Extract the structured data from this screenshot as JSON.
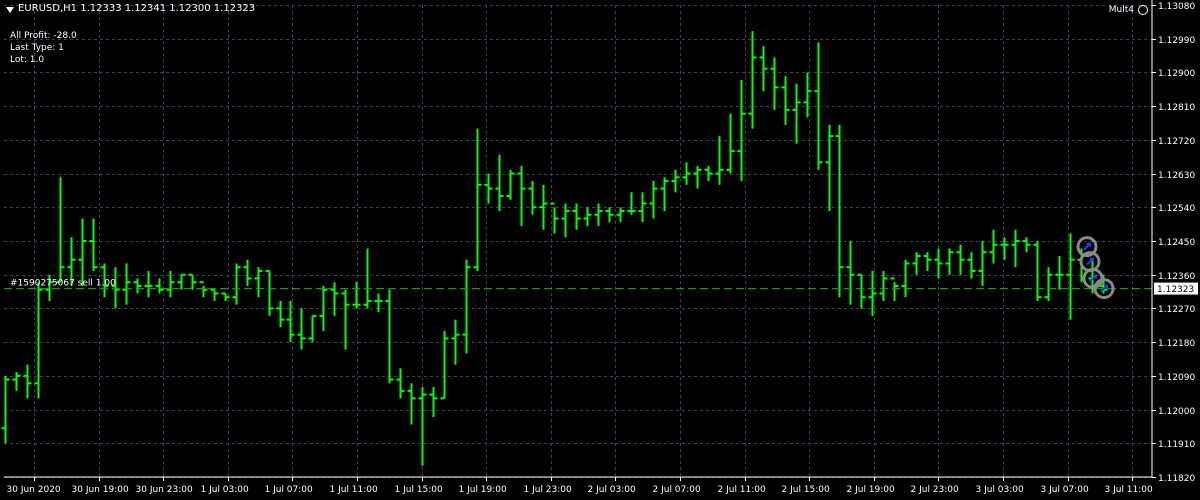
{
  "header": {
    "symbol": "EURUSD,H1",
    "ohlc": "1.12333 1.12341 1.12300 1.12323"
  },
  "info_panel": {
    "all_profit": "All Profit: -28.0",
    "last_type": "Last Type: 1",
    "lot": "Lot: 1.0"
  },
  "ea_label": "Mult4",
  "colors": {
    "background": "#000000",
    "bars": "#00FF00",
    "grid": "#394452",
    "order_line": "#00C000",
    "axis": "#FFFFFF",
    "price_label_bg": "#FFFFFF",
    "price_label_text": "#000000",
    "marker_ring": "#8A8A8A",
    "marker_arrow": "#1E3CFF"
  },
  "chart_data": {
    "type": "ohlc",
    "symbol": "EURUSD",
    "timeframe": "H1",
    "ylim": [
      1.1182,
      1.1308
    ],
    "y_ticks": [
      "1.13080",
      "1.12990",
      "1.12900",
      "1.12810",
      "1.12720",
      "1.12630",
      "1.12540",
      "1.12450",
      "1.12360",
      "1.12270",
      "1.12180",
      "1.12090",
      "1.12000",
      "1.11910",
      "1.11820"
    ],
    "x_ticks": [
      "30 Jun 2020",
      "30 Jun 19:00",
      "30 Jun 23:00",
      "1 Jul 03:00",
      "1 Jul 07:00",
      "1 Jul 11:00",
      "1 Jul 15:00",
      "1 Jul 19:00",
      "1 Jul 23:00",
      "2 Jul 03:00",
      "2 Jul 07:00",
      "2 Jul 11:00",
      "2 Jul 15:00",
      "2 Jul 19:00",
      "2 Jul 23:00",
      "3 Jul 03:00",
      "3 Jul 07:00",
      "3 Jul 11:00"
    ],
    "current_price": "1.12323",
    "order_line": {
      "label": "#1590275067 sell 1.00",
      "price": 1.12323
    },
    "bars": [
      [
        1.1195,
        1.1209,
        1.1191,
        1.1208
      ],
      [
        1.1208,
        1.121,
        1.1205,
        1.1209
      ],
      [
        1.1209,
        1.1212,
        1.1203,
        1.1207
      ],
      [
        1.1207,
        1.1234,
        1.1203,
        1.1232
      ],
      [
        1.1232,
        1.1236,
        1.1229,
        1.1234
      ],
      [
        1.1234,
        1.1262,
        1.1234,
        1.1238
      ],
      [
        1.1238,
        1.1246,
        1.1233,
        1.124
      ],
      [
        1.124,
        1.1251,
        1.1233,
        1.1245
      ],
      [
        1.1245,
        1.1251,
        1.1237,
        1.1238
      ],
      [
        1.1238,
        1.1239,
        1.123,
        1.1233
      ],
      [
        1.1233,
        1.1238,
        1.1227,
        1.1232
      ],
      [
        1.1232,
        1.1239,
        1.1228,
        1.1234
      ],
      [
        1.1234,
        1.1235,
        1.1231,
        1.1233
      ],
      [
        1.1233,
        1.1237,
        1.123,
        1.1233
      ],
      [
        1.1233,
        1.1235,
        1.1231,
        1.1232
      ],
      [
        1.1232,
        1.1237,
        1.123,
        1.1234
      ],
      [
        1.1234,
        1.1236,
        1.1232,
        1.1236
      ],
      [
        1.1236,
        1.1236,
        1.1232,
        1.1234
      ],
      [
        1.1234,
        1.1233,
        1.123,
        1.1232
      ],
      [
        1.1232,
        1.1232,
        1.1229,
        1.1231
      ],
      [
        1.1231,
        1.1231,
        1.1229,
        1.123
      ],
      [
        1.123,
        1.1239,
        1.1228,
        1.1238
      ],
      [
        1.1238,
        1.124,
        1.1233,
        1.1235
      ],
      [
        1.1235,
        1.1238,
        1.123,
        1.1237
      ],
      [
        1.1237,
        1.1237,
        1.1225,
        1.1227
      ],
      [
        1.1227,
        1.1229,
        1.1222,
        1.1224
      ],
      [
        1.1224,
        1.1229,
        1.1218,
        1.122
      ],
      [
        1.122,
        1.1227,
        1.1216,
        1.1219
      ],
      [
        1.1219,
        1.1225,
        1.1218,
        1.1225
      ],
      [
        1.1225,
        1.1233,
        1.1221,
        1.1232
      ],
      [
        1.1232,
        1.1234,
        1.1225,
        1.1231
      ],
      [
        1.1231,
        1.1232,
        1.1216,
        1.1228
      ],
      [
        1.1228,
        1.1234,
        1.1227,
        1.1228
      ],
      [
        1.1228,
        1.1243,
        1.1227,
        1.1229
      ],
      [
        1.1229,
        1.1231,
        1.1226,
        1.1229
      ],
      [
        1.1229,
        1.1232,
        1.1207,
        1.1208
      ],
      [
        1.1208,
        1.1211,
        1.1203,
        1.1205
      ],
      [
        1.1205,
        1.1207,
        1.1196,
        1.1203
      ],
      [
        1.1203,
        1.1206,
        1.1185,
        1.1204
      ],
      [
        1.1204,
        1.1206,
        1.1198,
        1.1203
      ],
      [
        1.1203,
        1.1221,
        1.1203,
        1.1219
      ],
      [
        1.1219,
        1.1224,
        1.1212,
        1.122
      ],
      [
        1.122,
        1.124,
        1.1215,
        1.1238
      ],
      [
        1.1238,
        1.1275,
        1.1237,
        1.126
      ],
      [
        1.126,
        1.1263,
        1.1255,
        1.1259
      ],
      [
        1.1259,
        1.1268,
        1.1253,
        1.1257
      ],
      [
        1.1257,
        1.1264,
        1.1256,
        1.1263
      ],
      [
        1.1263,
        1.1265,
        1.1249,
        1.1259
      ],
      [
        1.1259,
        1.1261,
        1.1252,
        1.1254
      ],
      [
        1.1254,
        1.126,
        1.1248,
        1.1255
      ],
      [
        1.1255,
        1.1254,
        1.1247,
        1.1251
      ],
      [
        1.1251,
        1.1255,
        1.1246,
        1.1253
      ],
      [
        1.1253,
        1.1255,
        1.1248,
        1.1251
      ],
      [
        1.1251,
        1.1254,
        1.1249,
        1.1252
      ],
      [
        1.1252,
        1.1255,
        1.1249,
        1.1253
      ],
      [
        1.1253,
        1.1254,
        1.125,
        1.1252
      ],
      [
        1.1252,
        1.1254,
        1.125,
        1.1253
      ],
      [
        1.1253,
        1.1258,
        1.1252,
        1.1253
      ],
      [
        1.1253,
        1.1258,
        1.125,
        1.1255
      ],
      [
        1.1255,
        1.1261,
        1.1251,
        1.1259
      ],
      [
        1.1259,
        1.1262,
        1.1253,
        1.1261
      ],
      [
        1.1261,
        1.1264,
        1.1258,
        1.1262
      ],
      [
        1.1262,
        1.1266,
        1.126,
        1.1263
      ],
      [
        1.1263,
        1.1265,
        1.1259,
        1.1264
      ],
      [
        1.1264,
        1.1265,
        1.1261,
        1.1263
      ],
      [
        1.1263,
        1.1273,
        1.126,
        1.1264
      ],
      [
        1.1264,
        1.1279,
        1.1263,
        1.1269
      ],
      [
        1.1269,
        1.1288,
        1.1261,
        1.1279
      ],
      [
        1.1279,
        1.1301,
        1.1275,
        1.1294
      ],
      [
        1.1294,
        1.1297,
        1.1285,
        1.1291
      ],
      [
        1.1291,
        1.1294,
        1.128,
        1.1286
      ],
      [
        1.1286,
        1.1289,
        1.1276,
        1.128
      ],
      [
        1.128,
        1.1287,
        1.1271,
        1.1282
      ],
      [
        1.1282,
        1.129,
        1.1278,
        1.1285
      ],
      [
        1.1285,
        1.1298,
        1.1264,
        1.1266
      ],
      [
        1.1266,
        1.1276,
        1.1253,
        1.1273
      ],
      [
        1.1273,
        1.1276,
        1.123,
        1.1238
      ],
      [
        1.1238,
        1.1245,
        1.1228,
        1.1236
      ],
      [
        1.1236,
        1.1236,
        1.1227,
        1.123
      ],
      [
        1.123,
        1.1237,
        1.1225,
        1.1231
      ],
      [
        1.1231,
        1.1237,
        1.1229,
        1.1235
      ],
      [
        1.1235,
        1.1234,
        1.1229,
        1.1233
      ],
      [
        1.1233,
        1.124,
        1.123,
        1.1239
      ],
      [
        1.1239,
        1.1242,
        1.1236,
        1.1241
      ],
      [
        1.1241,
        1.1242,
        1.1237,
        1.124
      ],
      [
        1.124,
        1.1243,
        1.1235,
        1.1239
      ],
      [
        1.1239,
        1.1243,
        1.1236,
        1.1242
      ],
      [
        1.1242,
        1.1244,
        1.1236,
        1.124
      ],
      [
        1.124,
        1.1242,
        1.1235,
        1.1237
      ],
      [
        1.1237,
        1.1245,
        1.1233,
        1.1242
      ],
      [
        1.1242,
        1.1248,
        1.1239,
        1.1244
      ],
      [
        1.1244,
        1.1246,
        1.124,
        1.1244
      ],
      [
        1.1244,
        1.1248,
        1.1238,
        1.1245
      ],
      [
        1.1245,
        1.1246,
        1.1242,
        1.1244
      ],
      [
        1.1244,
        1.1245,
        1.1229,
        1.123
      ],
      [
        1.123,
        1.1238,
        1.1229,
        1.1236
      ],
      [
        1.1236,
        1.1241,
        1.1232,
        1.1236
      ],
      [
        1.1236,
        1.1247,
        1.1224,
        1.124
      ],
      [
        1.124,
        1.1243,
        1.1234,
        1.1235
      ],
      [
        1.1235,
        1.124,
        1.1231,
        1.1233
      ],
      [
        1.1233,
        1.1236,
        1.1231,
        1.1232
      ]
    ]
  }
}
